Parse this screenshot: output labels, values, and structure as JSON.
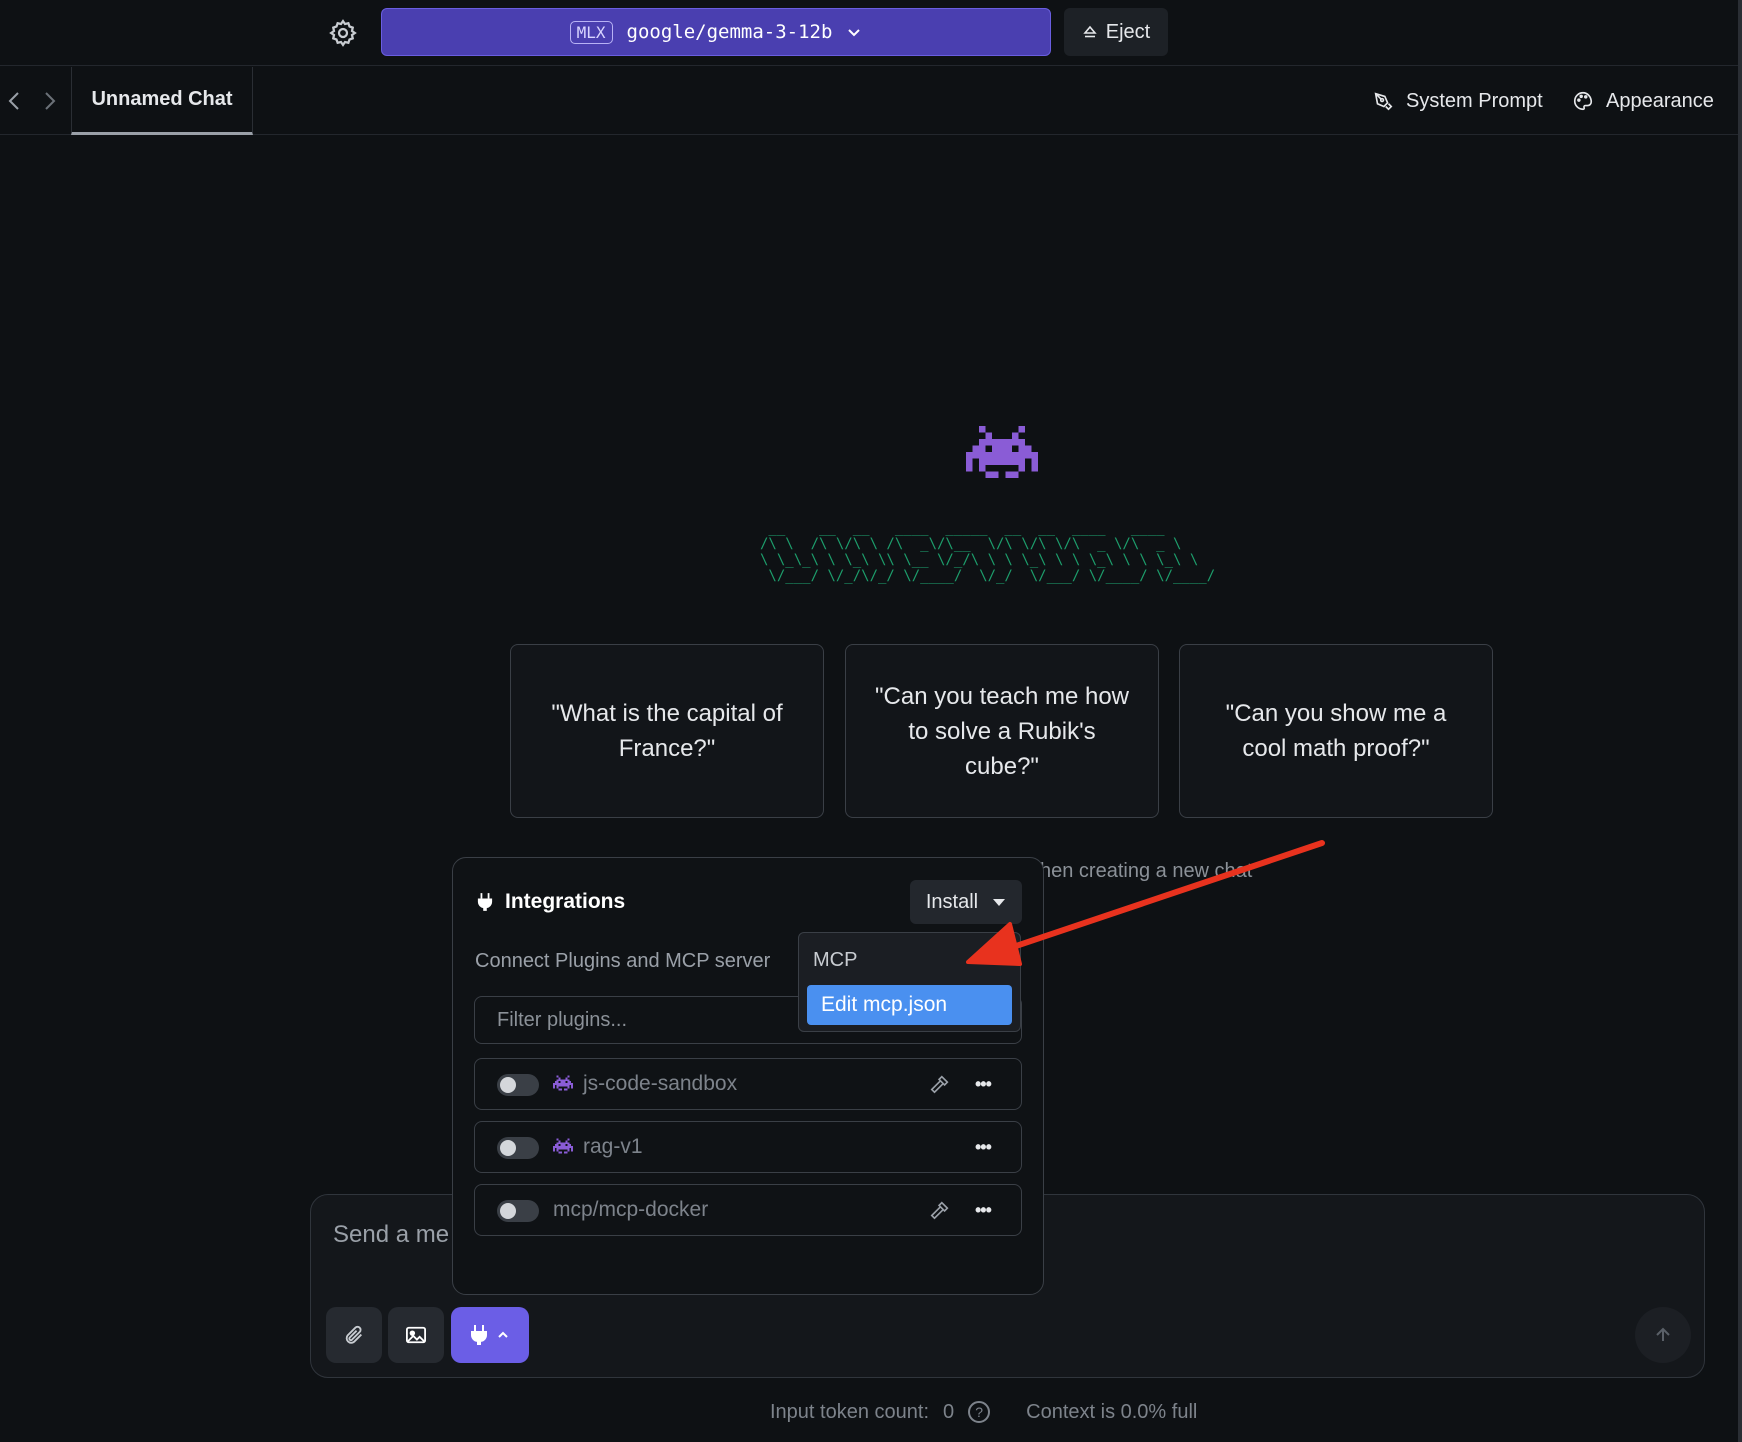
{
  "header": {
    "model_badge": "MLX",
    "model_name": "google/gemma-3-12b",
    "eject_label": "Eject"
  },
  "tabbar": {
    "tab_title": "Unnamed Chat",
    "system_prompt_label": "System Prompt",
    "appearance_label": "Appearance"
  },
  "welcome": {
    "ascii_logo": " __    __  __   ____  _____  __  __  ____   ____ \n/\\ \\  /\\ \\/\\ \\ /\\  _\\/\\__  \\/\\ \\/\\ \\/\\  _ \\/\\  _ \\\n\\ \\_\\_\\ \\ \\_\\ \\\\ \\__ \\/_/\\ \\ \\ \\_\\ \\ \\ \\_\\ \\ \\ \\_\\ \\\n \\/___/ \\/_/\\/_/ \\/____/  \\/_/  \\/___/ \\/____/ \\/____/",
    "suggestions": [
      "\"What is the capital of France?\"",
      "\"Can you teach me how to solve a Rubik's cube?\"",
      "\"Can you show me a cool math proof?\""
    ],
    "hint_fragment": "hen creating a new chat"
  },
  "composer": {
    "placeholder_visible": "Send a me",
    "input_token_label": "Input token count:",
    "input_token_value": "0",
    "context_label": "Context is 0.0% full"
  },
  "integrations": {
    "title": "Integrations",
    "install_label": "Install",
    "description": "Connect Plugins and MCP server",
    "filter_placeholder": "Filter plugins...",
    "plugins": [
      {
        "name": "js-code-sandbox",
        "enabled": false,
        "icon": "alien-icon",
        "has_tools": true
      },
      {
        "name": "rag-v1",
        "enabled": false,
        "icon": "alien-icon",
        "has_tools": false
      },
      {
        "name": "mcp/mcp-docker",
        "enabled": false,
        "icon": "none",
        "has_tools": true
      }
    ],
    "more_label": "•••"
  },
  "install_menu": {
    "section_header": "MCP",
    "item_label": "Edit mcp.json"
  },
  "colors": {
    "background": "#0e1114",
    "model_button": "#4a3fb0",
    "accent_purple": "#6b5ee6",
    "menu_highlight": "#4a90f0",
    "logo_green": "#1d9e6c",
    "annotation_arrow": "#e8321e"
  }
}
